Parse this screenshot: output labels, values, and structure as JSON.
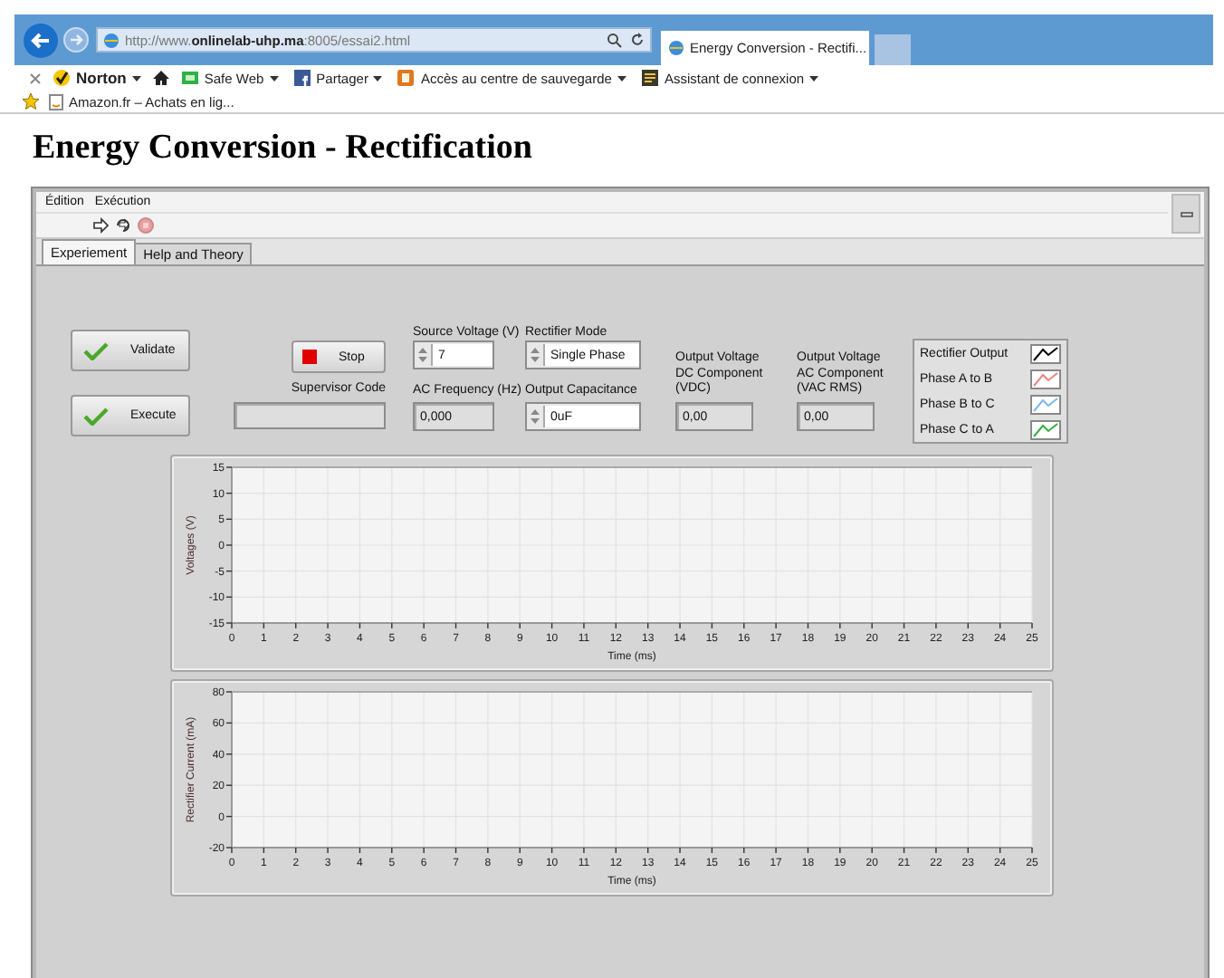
{
  "browser": {
    "address": "http://www.**onlinelab-uhp.ma**:8005/essai2.html",
    "tab_title": "Energy Conversion - Rectifi...",
    "toolbar": [
      {
        "label": "Norton",
        "kind": "norton",
        "bold": true
      },
      {
        "label": "Safe Web",
        "kind": "safeweb",
        "bold": false
      },
      {
        "label": "Partager",
        "kind": "share",
        "bold": false
      },
      {
        "label": "Accès au centre de sauvegarde",
        "kind": "backup",
        "bold": false
      },
      {
        "label": "Assistant de connexion",
        "kind": "assistant",
        "bold": false
      }
    ],
    "favorites": [
      {
        "label": "Amazon.fr – Achats en lig..."
      }
    ]
  },
  "heading": "Energy Conversion - Rectification",
  "panel": {
    "menu": [
      "Édition",
      "Exécution"
    ],
    "tabs": [
      {
        "label": "Experiement",
        "selected": true
      },
      {
        "label": "Help and Theory",
        "selected": false
      }
    ],
    "buttons": [
      {
        "label": "Validate"
      },
      {
        "label": "Execute"
      }
    ],
    "stop_button": {
      "label": "Stop"
    },
    "supervisor_code": {
      "label": "Supervisor Code"
    },
    "source_voltage": {
      "label": "Source Voltage (V)",
      "value": "7"
    },
    "ac_frequency": {
      "label": "AC Frequency (Hz)",
      "value": "0,000"
    },
    "rectifier_mode": {
      "label": "Rectifier Mode",
      "value": "Single Phase"
    },
    "output_capacitance": {
      "label": "Output Capacitance",
      "value": "0uF"
    },
    "dc_output": {
      "label": "Output Voltage DC Component (VDC)",
      "value": "0,00"
    },
    "ac_output": {
      "label": "Output Voltage AC Component (VAC RMS)",
      "value": "0,00"
    },
    "legend": [
      {
        "name": "Rectifier Output",
        "color": "#000000"
      },
      {
        "name": "Phase A to B",
        "color": "#f08080"
      },
      {
        "name": "Phase B to C",
        "color": "#7ab8f0"
      },
      {
        "name": "Phase C to A",
        "color": "#30b040"
      }
    ],
    "charts": [
      {
        "chart_data": {
          "type": "line",
          "xlabel": "Time (ms)",
          "ylabel": "Voltages (V)",
          "grid": true,
          "xlim": [
            0,
            25
          ],
          "ylim": [
            -15,
            15
          ],
          "xticks": [
            0,
            1,
            2,
            3,
            4,
            5,
            6,
            7,
            8,
            9,
            10,
            11,
            12,
            13,
            14,
            15,
            16,
            17,
            18,
            19,
            20,
            21,
            22,
            23,
            24,
            25
          ],
          "yticks": [
            -15,
            -10,
            -5,
            0,
            5,
            10,
            15
          ]
        }
      },
      {
        "chart_data": {
          "type": "line",
          "xlabel": "Time (ms)",
          "ylabel": "Rectifier Current (mA)",
          "grid": true,
          "xlim": [
            0,
            25
          ],
          "ylim": [
            -20,
            80
          ],
          "xticks": [
            0,
            1,
            2,
            3,
            4,
            5,
            6,
            7,
            8,
            9,
            10,
            11,
            12,
            13,
            14,
            15,
            16,
            17,
            18,
            19,
            20,
            21,
            22,
            23,
            24,
            25
          ],
          "yticks": [
            -20,
            0,
            20,
            40,
            60,
            80
          ]
        }
      }
    ]
  }
}
